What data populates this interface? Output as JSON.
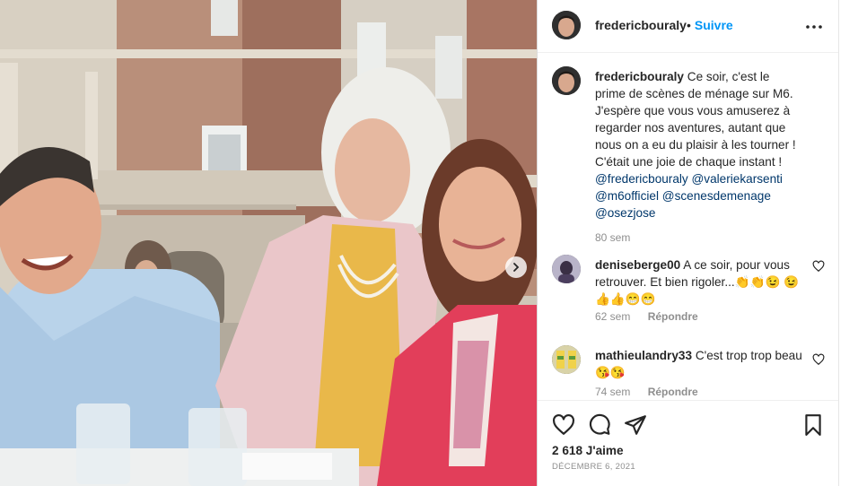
{
  "post": {
    "author": "fredericbouraly",
    "follow_label": "Suivre",
    "follow_separator": "•",
    "caption_text": "Ce soir, c'est le prime de scènes de ménage sur M6. J'espère que vous vous amuserez à regarder nos aventures, autant que nous on a eu du plaisir à les tourner ! C'était une joie de chaque instant !",
    "mentions": [
      "@fredericbouraly",
      "@valeriekarsenti",
      "@m6officiel",
      "@scenesdemenage",
      "@osezjose"
    ],
    "caption_time": "80 sem",
    "likes": "2 618 J'aime",
    "date": "DÉCEMBRE 6, 2021"
  },
  "comments": [
    {
      "user": "deniseberge00",
      "text": "A ce soir, pour vous retrouver. Et bien rigoler...👏👏😉 😉👍👍😁😁",
      "time": "62 sem",
      "reply_label": "Répondre"
    },
    {
      "user": "mathieulandry33",
      "text": "C'est trop trop beau 😘😘",
      "time": "74 sem",
      "reply_label": "Répondre"
    }
  ],
  "icons": {
    "more": "more-horizontal-icon",
    "like": "heart-icon",
    "comment": "comment-icon",
    "share": "send-icon",
    "save": "bookmark-icon",
    "next": "chevron-right-icon"
  },
  "colors": {
    "link": "#0095f6",
    "mention": "#00376b",
    "muted": "#8e8e8e",
    "text": "#262626"
  }
}
